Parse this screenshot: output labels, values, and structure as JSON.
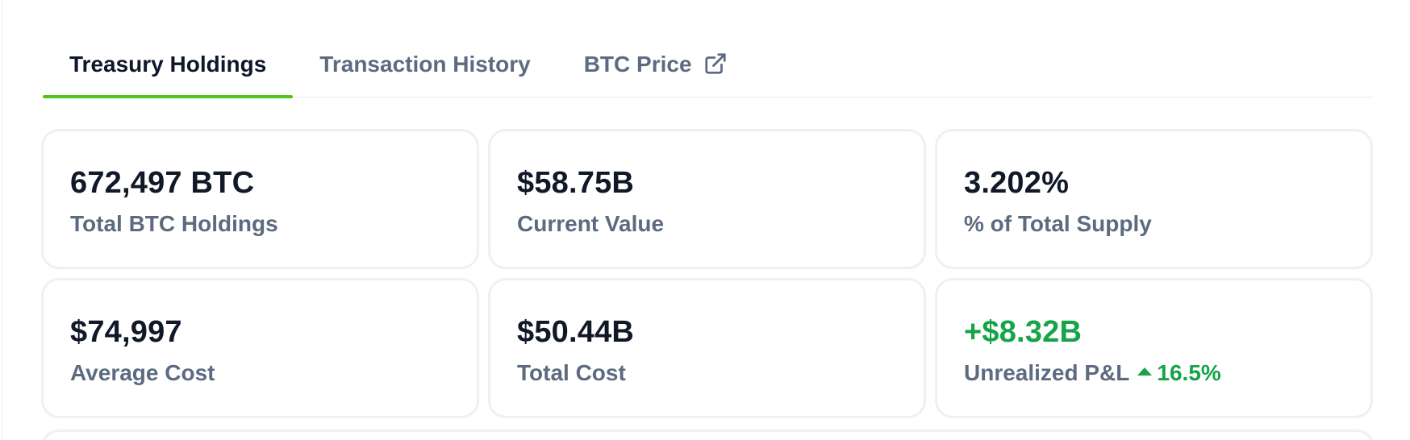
{
  "tabs": [
    {
      "label": "Treasury Holdings",
      "active": true
    },
    {
      "label": "Transaction History",
      "active": false
    },
    {
      "label": "BTC Price",
      "active": false,
      "icon": "external-link-icon"
    }
  ],
  "stats": [
    {
      "value": "672,497 BTC",
      "label": "Total BTC Holdings"
    },
    {
      "value": "$58.75B",
      "label": "Current Value"
    },
    {
      "value": "3.202%",
      "label": "% of Total Supply"
    },
    {
      "value": "$74,997",
      "label": "Average Cost"
    },
    {
      "value": "$50.44B",
      "label": "Total Cost"
    },
    {
      "value": "+$8.32B",
      "label": "Unrealized P&L",
      "change": "16.5%",
      "change_icon": "caret-up-icon"
    }
  ],
  "colors": {
    "accent": "#52c41a",
    "positive": "#16a34a",
    "text_primary": "#111827",
    "text_muted": "#5d6b80",
    "card_border": "#eef0f3"
  }
}
